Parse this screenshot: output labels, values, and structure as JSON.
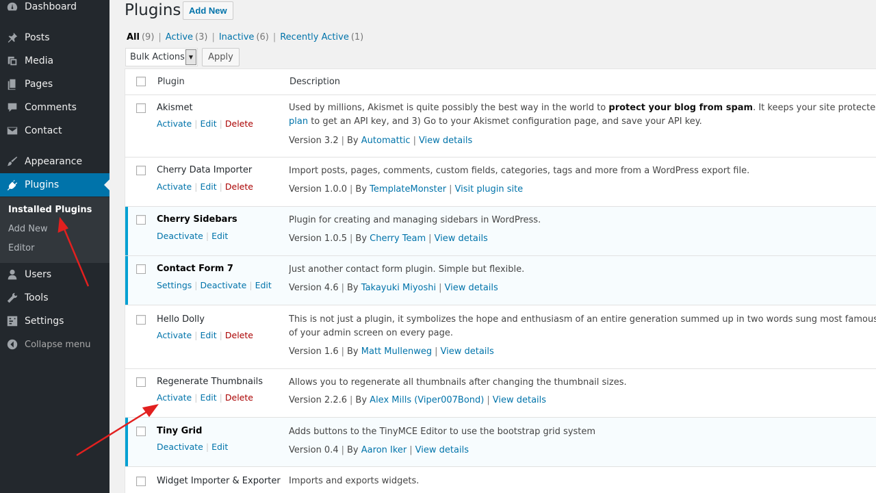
{
  "sidebar": {
    "items": [
      {
        "label": "Dashboard",
        "icon": "dashboard-icon"
      },
      {
        "label": "Posts",
        "icon": "pin-icon"
      },
      {
        "label": "Media",
        "icon": "media-icon"
      },
      {
        "label": "Pages",
        "icon": "pages-icon"
      },
      {
        "label": "Comments",
        "icon": "comment-icon"
      },
      {
        "label": "Contact",
        "icon": "mail-icon"
      },
      {
        "label": "Appearance",
        "icon": "brush-icon"
      },
      {
        "label": "Plugins",
        "icon": "plugin-icon"
      },
      {
        "label": "Users",
        "icon": "user-icon"
      },
      {
        "label": "Tools",
        "icon": "wrench-icon"
      },
      {
        "label": "Settings",
        "icon": "settings-icon"
      },
      {
        "label": "Collapse menu",
        "icon": "collapse-icon"
      }
    ],
    "submenu": [
      "Installed Plugins",
      "Add New",
      "Editor"
    ]
  },
  "header": {
    "title": "Plugins",
    "add_new": "Add New"
  },
  "filters": {
    "all": "All",
    "all_count": "(9)",
    "active": "Active",
    "active_count": "(3)",
    "inactive": "Inactive",
    "inactive_count": "(6)",
    "recent": "Recently Active",
    "recent_count": "(1)",
    "separator": "|"
  },
  "bulk": {
    "label": "Bulk Actions",
    "apply": "Apply"
  },
  "table": {
    "col_plugin": "Plugin",
    "col_desc": "Description",
    "sep": "|",
    "plugins": [
      {
        "name": "Akismet",
        "actions": [
          "Activate",
          "Edit",
          "Delete"
        ],
        "desc_1a": "Used by millions, Akismet is quite possibly the best way in the world to ",
        "desc_1b": "protect your blog from spam",
        "desc_1c": ". It keeps your site protected even while you s",
        "desc_2a": "plan",
        "desc_2b": " to get an API key, and 3) Go to your Akismet configuration page, and save your API key.",
        "version": "Version 3.2",
        "by": "By",
        "author": "Automattic",
        "link": "View details"
      },
      {
        "name": "Cherry Data Importer",
        "actions": [
          "Activate",
          "Edit",
          "Delete"
        ],
        "desc": "Import posts, pages, comments, custom fields, categories, tags and more from a WordPress export file.",
        "version": "Version 1.0.0",
        "by": "By",
        "author": "TemplateMonster",
        "link": "Visit plugin site"
      },
      {
        "name": "Cherry Sidebars",
        "actions": [
          "Deactivate",
          "Edit"
        ],
        "desc": "Plugin for creating and managing sidebars in WordPress.",
        "version": "Version 1.0.5",
        "by": "By",
        "author": "Cherry Team",
        "link": "View details"
      },
      {
        "name": "Contact Form 7",
        "actions": [
          "Settings",
          "Deactivate",
          "Edit"
        ],
        "desc": "Just another contact form plugin. Simple but flexible.",
        "version": "Version 4.6",
        "by": "By",
        "author": "Takayuki Miyoshi",
        "link": "View details"
      },
      {
        "name": "Hello Dolly",
        "actions": [
          "Activate",
          "Edit",
          "Delete"
        ],
        "desc_1": "This is not just a plugin, it symbolizes the hope and enthusiasm of an entire generation summed up in two words sung most famously by Louis Arm",
        "desc_2": "of your admin screen on every page.",
        "version": "Version 1.6",
        "by": "By",
        "author": "Matt Mullenweg",
        "link": "View details"
      },
      {
        "name": "Regenerate Thumbnails",
        "actions": [
          "Activate",
          "Edit",
          "Delete"
        ],
        "desc": "Allows you to regenerate all thumbnails after changing the thumbnail sizes.",
        "version": "Version 2.2.6",
        "by": "By",
        "author": "Alex Mills (Viper007Bond)",
        "link": "View details"
      },
      {
        "name": "Tiny Grid",
        "actions": [
          "Deactivate",
          "Edit"
        ],
        "desc": "Adds buttons to the TinyMCE Editor to use the bootstrap grid system",
        "version": "Version 0.4",
        "by": "By",
        "author": "Aaron Iker",
        "link": "View details"
      },
      {
        "name": "Widget Importer & Exporter",
        "desc": "Imports and exports widgets."
      }
    ]
  },
  "colors": {
    "sidebar": "#23282d",
    "accent": "#0073aa",
    "active_border": "#00a0d2",
    "delete": "#aa0000",
    "annotation_arrow": "#e2201f"
  }
}
